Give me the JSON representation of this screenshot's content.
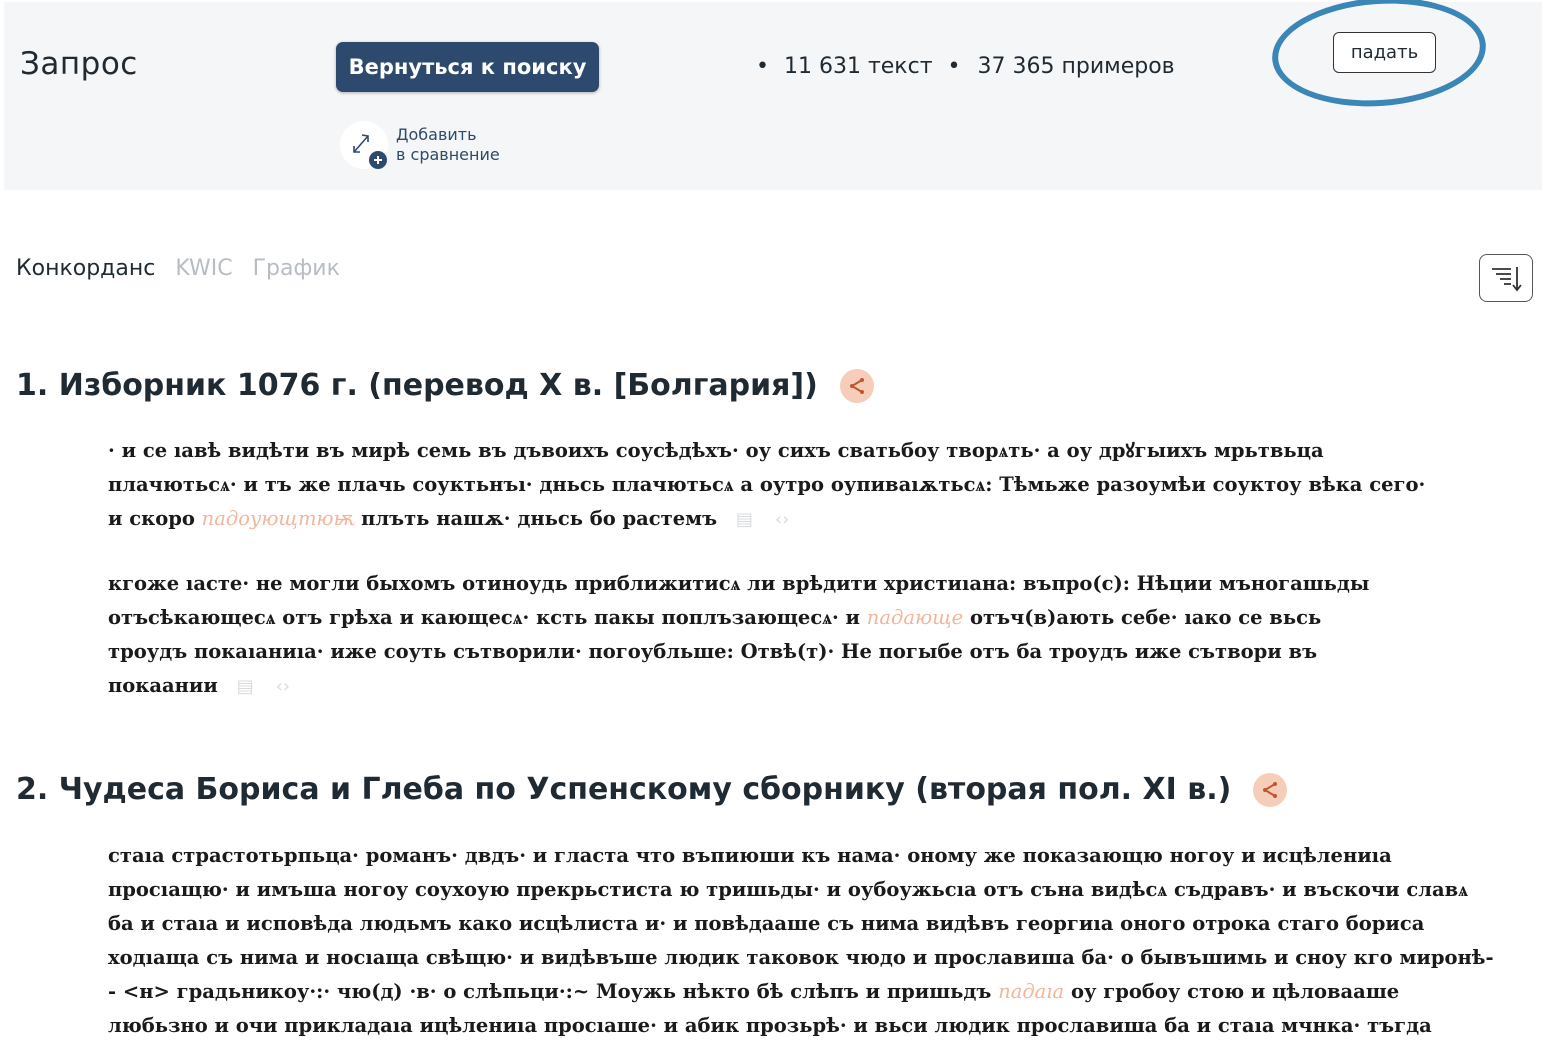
{
  "header": {
    "title": "Запрос",
    "back_button": "Вернуться к поиску",
    "stats_texts": "11 631 текст",
    "stats_examples": "37 365 примеров",
    "bullet": "•",
    "query_word": "падать",
    "compare_line1": "Добавить",
    "compare_line2": "в сравнение"
  },
  "tabs": [
    {
      "label": "Конкорданс",
      "active": true
    },
    {
      "label": "KWIC",
      "active": false
    },
    {
      "label": "График",
      "active": false
    }
  ],
  "results": [
    {
      "title": "1. Изборник 1076 г. (перевод X в. [Болгария])",
      "snippets": [
        {
          "lines": [
            {
              "before": "· и се ıавѣ видѣти въ мирѣ семь въ дъвоихъ соусѣдѣхъ· оу сихъ сватьбоу творѧть· а оу дрꙋгыихъ мрьтвьца",
              "hit": "",
              "after": ""
            },
            {
              "before": "плачютьсѧ· и тъ же плачь соуктьнъı· дньсь плачютьсѧ а оутро оупиваıѫтьсѧ: Тѣмьже разоумѣи соуктоу вѣка сего·",
              "hit": "",
              "after": ""
            },
            {
              "before": "и скоро ",
              "hit": "падоующтюѭ",
              "after": " плъть нашѫ· дньсь бо растемъ"
            }
          ]
        },
        {
          "lines": [
            {
              "before": "кгоже ıасте· не могли быхомъ отиноудь приближитисѧ ли врѣдити христиıана: въпро(с): Нѣции мъногашьды",
              "hit": "",
              "after": ""
            },
            {
              "before": "отъсѣкающесѧ отъ грѣха и кающесѧ· ксть пакы поплъзающесѧ· и ",
              "hit": "падающе",
              "after": " отъч(в)ають себе· ıако се вьсь"
            },
            {
              "before": "троудъ покаıаниıа· иже соуть сътворили· погоубльше: Отвѣ(т)· Не погыбе отъ ба троудъ иже сътвори въ",
              "hit": "",
              "after": ""
            },
            {
              "before": "покаании",
              "hit": "",
              "after": ""
            }
          ]
        }
      ]
    },
    {
      "title": "2. Чудеса Бориса и Глеба по Успенскому сборнику (вторая пол. XI в.)",
      "snippets": [
        {
          "lines": [
            {
              "before": "стаıа страстотьрпьца· романъ· двдъ· и гласта что въпиюши къ нама· оному же показающю ногоу и исцѣлениıа",
              "hit": "",
              "after": ""
            },
            {
              "before": "просıащю· и имъша ногоу соухоую прекрьстиста ю тришьды· и оубоужьсıа отъ съна видѣсѧ съдравъ· и въскочи славѧ",
              "hit": "",
              "after": ""
            },
            {
              "before": "ба и стаıа и исповѣда людьмъ како исцѣлиста и· и повѣдааше съ нима видѣвъ георгиıа оного отрока стаго бориса",
              "hit": "",
              "after": ""
            },
            {
              "before": "ходıаща съ нима и носıаща свѣщю· и видѣвъше людик таковок чюдо и прославиша ба· о бывъшимь и сноу кго миронѣ-",
              "hit": "",
              "after": ""
            },
            {
              "before": "- <н> градьникоу·:· чю(д) ·в· о слѣпьци·:~ Моужь нѣкто бѣ слѣпъ и пришьдъ ",
              "hit": "падаıа",
              "after": " оу гробоу стою и цѣловааше"
            },
            {
              "before": "любьзно и очи прикладаıа ицѣлениıа просıаше· и абик прозьрѣ· и вьси людик прославиша ба и стаıа мчнка· тъгда",
              "hit": "",
              "after": ""
            }
          ]
        }
      ]
    }
  ]
}
